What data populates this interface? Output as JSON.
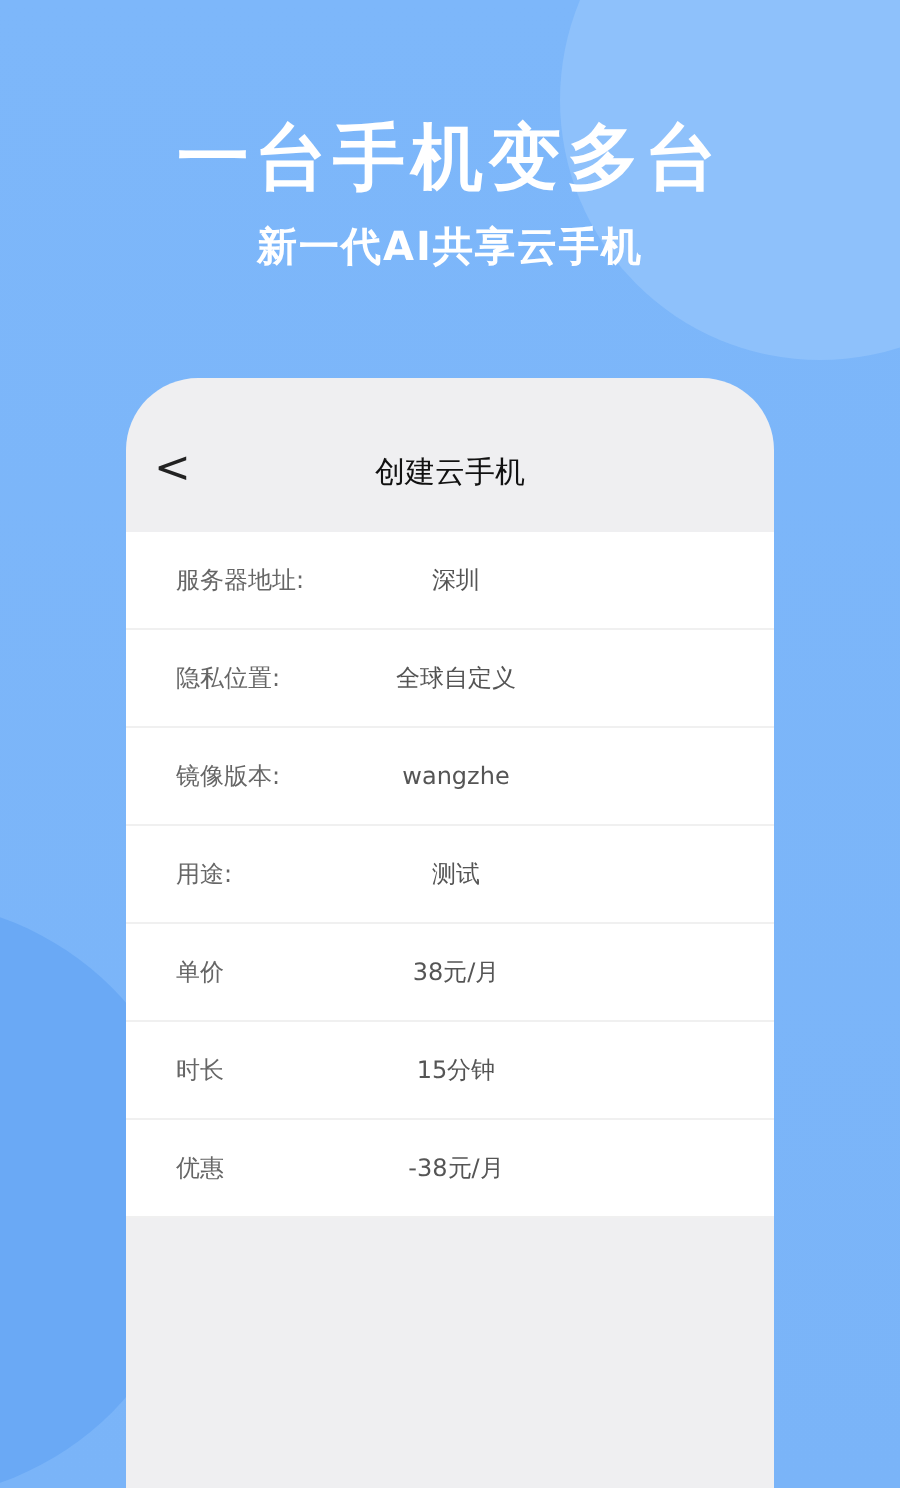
{
  "headline": "一台手机变多台",
  "subheadline": "新一代AI共享云手机",
  "phone_screen": {
    "back": "<",
    "title": "创建云手机",
    "rows": [
      {
        "label": "服务器地址:",
        "value": "深圳"
      },
      {
        "label": "隐私位置:",
        "value": "全球自定义"
      },
      {
        "label": "镜像版本:",
        "value": "wangzhe"
      },
      {
        "label": "用途:",
        "value": "测试"
      },
      {
        "label": "单价",
        "value": "38元/月"
      },
      {
        "label": "时长",
        "value": "15分钟"
      },
      {
        "label": "优惠",
        "value": "-38元/月"
      }
    ]
  }
}
